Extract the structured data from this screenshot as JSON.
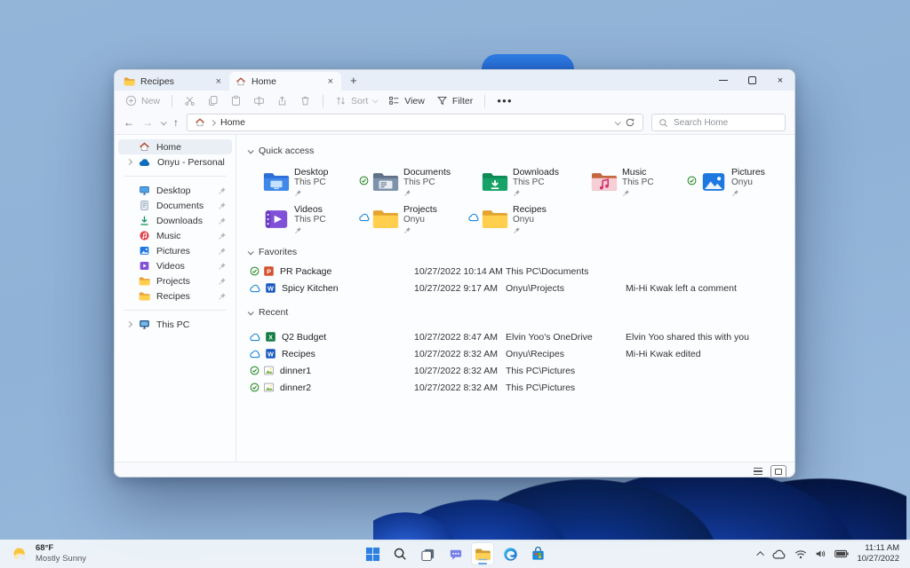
{
  "icons": {
    "back": "←",
    "forward": "→",
    "up": "↑",
    "close": "×",
    "new_tab": "+",
    "more": "●●●"
  },
  "window": {
    "tabs": [
      {
        "label": "Recipes"
      },
      {
        "label": "Home"
      }
    ],
    "toolbar": {
      "new": "New",
      "sort": "Sort",
      "view": "View",
      "filter": "Filter"
    },
    "address": {
      "root": "Home",
      "search_placeholder": "Search Home"
    },
    "sidebar": {
      "top": [
        {
          "label": "Home"
        },
        {
          "label": "Onyu - Personal"
        }
      ],
      "pinned": [
        {
          "label": "Desktop"
        },
        {
          "label": "Documents"
        },
        {
          "label": "Downloads"
        },
        {
          "label": "Music"
        },
        {
          "label": "Pictures"
        },
        {
          "label": "Videos"
        },
        {
          "label": "Projects"
        },
        {
          "label": "Recipes"
        }
      ],
      "bottom": [
        {
          "label": "This PC"
        }
      ]
    },
    "sections": {
      "quick_access": {
        "title": "Quick access",
        "items": [
          {
            "name": "Desktop",
            "location": "This PC",
            "badge": ""
          },
          {
            "name": "Documents",
            "location": "This PC",
            "badge": "synced"
          },
          {
            "name": "Downloads",
            "location": "This PC",
            "badge": ""
          },
          {
            "name": "Music",
            "location": "This PC",
            "badge": ""
          },
          {
            "name": "Pictures",
            "location": "Onyu",
            "badge": "synced"
          },
          {
            "name": "Videos",
            "location": "This PC",
            "badge": ""
          },
          {
            "name": "Projects",
            "location": "Onyu",
            "badge": "cloud"
          },
          {
            "name": "Recipes",
            "location": "Onyu",
            "badge": "cloud"
          }
        ]
      },
      "favorites": {
        "title": "Favorites",
        "rows": [
          {
            "name": "PR Package",
            "date": "10/27/2022 10:14 AM",
            "location": "This PC\\Documents",
            "note": ""
          },
          {
            "name": "Spicy Kitchen",
            "date": "10/27/2022 9:17 AM",
            "location": "Onyu\\Projects",
            "note": "Mi-Hi Kwak left a comment"
          }
        ]
      },
      "recent": {
        "title": "Recent",
        "rows": [
          {
            "name": "Q2 Budget",
            "date": "10/27/2022 8:47 AM",
            "location": "Elvin Yoo's OneDrive",
            "note": "Elvin Yoo shared this with you"
          },
          {
            "name": "Recipes",
            "date": "10/27/2022 8:32 AM",
            "location": "Onyu\\Recipes",
            "note": "Mi-Hi Kwak edited"
          },
          {
            "name": "dinner1",
            "date": "10/27/2022 8:32 AM",
            "location": "This PC\\Pictures",
            "note": ""
          },
          {
            "name": "dinner2",
            "date": "10/27/2022 8:32 AM",
            "location": "This PC\\Pictures",
            "note": ""
          }
        ]
      }
    }
  },
  "taskbar": {
    "weather": {
      "temp": "68°F",
      "condition": "Mostly Sunny"
    },
    "clock": {
      "time": "11:11 AM",
      "date": "10/27/2022"
    }
  },
  "colors": {
    "accent": "#2a6fd8",
    "folder_yellow": "#ffcf4d",
    "sync_green": "#107c10",
    "cloud_blue": "#0078d4"
  }
}
